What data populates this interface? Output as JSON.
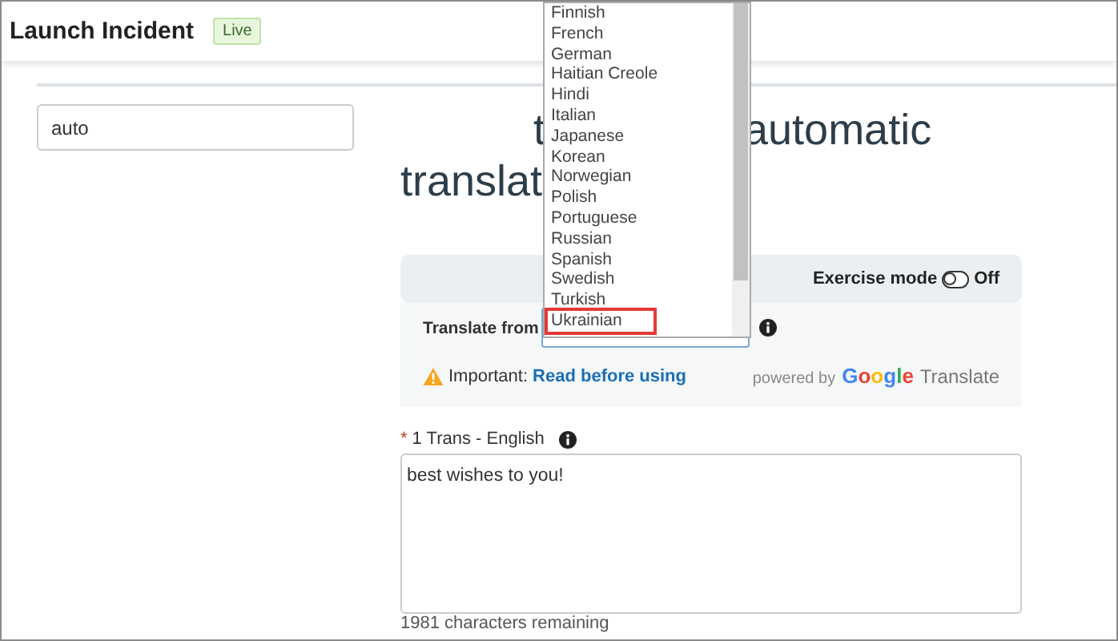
{
  "header": {
    "title": "Launch Incident",
    "badge": "Live"
  },
  "left_field": {
    "value": "auto"
  },
  "heading": {
    "line_1": [
      "t",
      "automatic"
    ],
    "line_2": "translat"
  },
  "exercise_mode": {
    "label": "Exercise mode",
    "on": false,
    "state_text": "Off"
  },
  "translate_from": {
    "label": "Translate from"
  },
  "language_list": [
    {
      "label": "Finnish",
      "selected": false
    },
    {
      "label": "French",
      "selected": false
    },
    {
      "label": "German",
      "selected": false
    },
    {
      "label": "Haitian Creole",
      "selected": false
    },
    {
      "label": "Hindi",
      "selected": false
    },
    {
      "label": "Italian",
      "selected": false
    },
    {
      "label": "Japanese",
      "selected": false
    },
    {
      "label": "Korean",
      "selected": false
    },
    {
      "label": "Norwegian",
      "selected": false
    },
    {
      "label": "Polish",
      "selected": false
    },
    {
      "label": "Portuguese",
      "selected": false
    },
    {
      "label": "Russian",
      "selected": false
    },
    {
      "label": "Spanish",
      "selected": false
    },
    {
      "label": "Swedish",
      "selected": false
    },
    {
      "label": "Turkish",
      "selected": false
    },
    {
      "label": "Ukrainian",
      "selected": true
    }
  ],
  "notice": {
    "label": "Important:",
    "link": "Read before using"
  },
  "powered_by": {
    "text": "powered by",
    "brand": "Google",
    "product": "Translate"
  },
  "translation": {
    "required_mark": "*",
    "label": "1 Trans - English",
    "value": "best wishes to you!",
    "remaining": "1981 characters remaining"
  }
}
